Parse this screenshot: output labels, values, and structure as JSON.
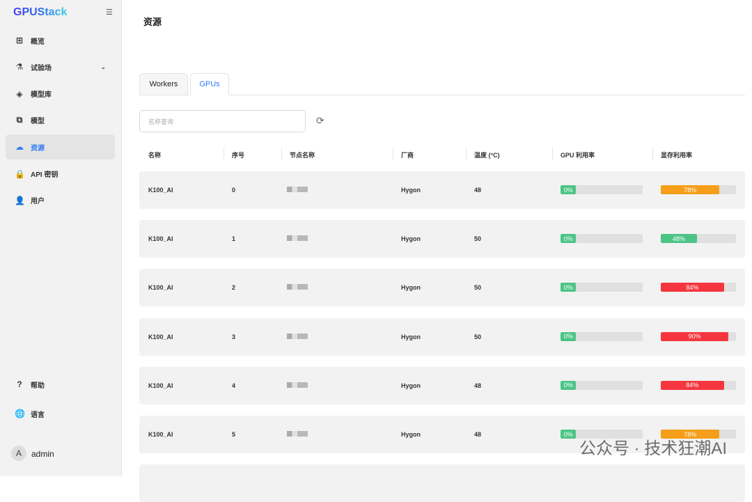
{
  "app": {
    "logo": "GPUStack"
  },
  "sidebar": {
    "items": [
      {
        "label": "概览",
        "icon": "grid-icon",
        "glyph": "⊞"
      },
      {
        "label": "试验场",
        "icon": "flask-icon",
        "glyph": "⚗"
      },
      {
        "label": "模型库",
        "icon": "layers-icon",
        "glyph": "◈"
      },
      {
        "label": "模型",
        "icon": "copy-icon",
        "glyph": "⧉"
      },
      {
        "label": "资源",
        "icon": "cloud-icon",
        "glyph": "☁"
      },
      {
        "label": "API 密钥",
        "icon": "lock-icon",
        "glyph": "🔒"
      },
      {
        "label": "用户",
        "icon": "users-icon",
        "glyph": "👤"
      }
    ],
    "help": "帮助",
    "language": "语言",
    "user": "admin",
    "avatar": "A"
  },
  "page": {
    "title": "资源",
    "tabs": [
      "Workers",
      "GPUs"
    ],
    "search_placeholder": "名称查询"
  },
  "table": {
    "headers": [
      "名称",
      "序号",
      "节点名称",
      "厂商",
      "温度 (°C)",
      "GPU 利用率",
      "显存利用率"
    ],
    "rows": [
      {
        "name": "K100_AI",
        "index": "0",
        "vendor": "Hygon",
        "temp": "48",
        "gpu": 0,
        "mem": 78
      },
      {
        "name": "K100_AI",
        "index": "1",
        "vendor": "Hygon",
        "temp": "50",
        "gpu": 0,
        "mem": 48
      },
      {
        "name": "K100_AI",
        "index": "2",
        "vendor": "Hygon",
        "temp": "50",
        "gpu": 0,
        "mem": 84
      },
      {
        "name": "K100_AI",
        "index": "3",
        "vendor": "Hygon",
        "temp": "50",
        "gpu": 0,
        "mem": 90
      },
      {
        "name": "K100_AI",
        "index": "4",
        "vendor": "Hygon",
        "temp": "48",
        "gpu": 0,
        "mem": 84
      },
      {
        "name": "K100_AI",
        "index": "5",
        "vendor": "Hygon",
        "temp": "48",
        "gpu": 0,
        "mem": 78
      }
    ]
  },
  "colors": {
    "low": "#4cc486",
    "mid": "#f59e1a",
    "high": "#f5363e"
  },
  "watermark": "公众号 · 技术狂潮AI"
}
